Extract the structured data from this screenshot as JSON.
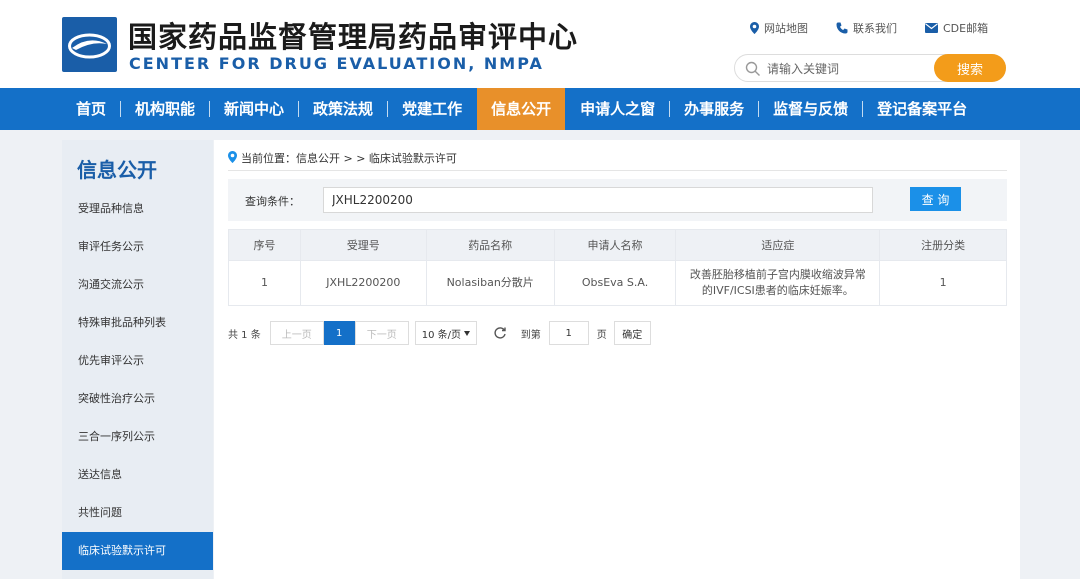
{
  "header": {
    "title_cn": "国家药品监督管理局药品审评中心",
    "title_en": "CENTER FOR DRUG EVALUATION, NMPA",
    "links": [
      {
        "label": "网站地图",
        "icon": "location-pin-icon"
      },
      {
        "label": "联系我们",
        "icon": "phone-icon"
      },
      {
        "label": "CDE邮箱",
        "icon": "mail-icon"
      }
    ],
    "search": {
      "placeholder": "请输入关键词",
      "button": "搜索"
    }
  },
  "nav": {
    "items": [
      "首页",
      "机构职能",
      "新闻中心",
      "政策法规",
      "党建工作",
      "信息公开",
      "申请人之窗",
      "办事服务",
      "监督与反馈",
      "登记备案平台"
    ],
    "active_index": 5
  },
  "sidebar": {
    "title": "信息公开",
    "items": [
      "受理品种信息",
      "审评任务公示",
      "沟通交流公示",
      "特殊审批品种列表",
      "优先审评公示",
      "突破性治疗公示",
      "三合一序列公示",
      "送达信息",
      "共性问题",
      "临床试验默示许可"
    ],
    "active_index": 9
  },
  "breadcrumb": "当前位置：信息公开 > > 临床试验默示许可",
  "query": {
    "label": "查询条件：",
    "value": "JXHL2200200",
    "button": "查 询"
  },
  "table": {
    "headers": [
      "序号",
      "受理号",
      "药品名称",
      "申请人名称",
      "适应症",
      "注册分类"
    ],
    "rows": [
      {
        "no": "1",
        "accept_no": "JXHL2200200",
        "drug": "Nolasiban分散片",
        "applicant": "ObsEva S.A.",
        "indication": "改善胚胎移植前子宫内膜收缩波异常的IVF/ICSI患者的临床妊娠率。",
        "category": "1"
      }
    ]
  },
  "pager": {
    "total": "共 1 条",
    "prev": "上一页",
    "current": "1",
    "next": "下一页",
    "page_size": "10 条/页",
    "goto_label": "到第",
    "goto_value": "1",
    "page_label": "页",
    "confirm": "确定"
  },
  "colors": {
    "primary": "#1470c8",
    "accent": "#e8902a",
    "search_button": "#f39c1a",
    "query_button": "#1b90e8"
  }
}
